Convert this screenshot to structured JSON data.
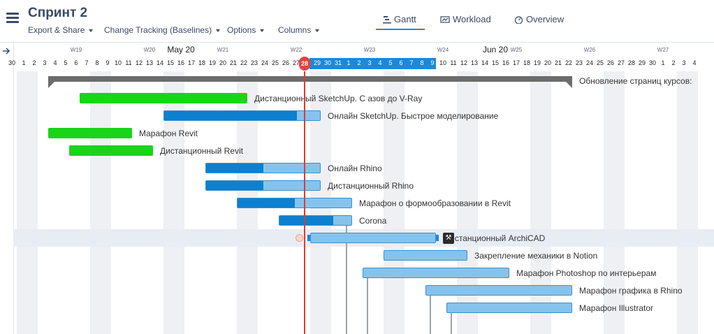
{
  "header": {
    "project_title": "Спринт 2",
    "menus": [
      {
        "label": "Export & Share"
      },
      {
        "label": "Change Tracking (Baselines)"
      },
      {
        "label": "Options"
      },
      {
        "label": "Columns"
      }
    ],
    "view_tabs": [
      {
        "label": "Gantt",
        "icon": "gantt-icon",
        "active": true
      },
      {
        "label": "Workload",
        "icon": "workload-icon",
        "active": false
      },
      {
        "label": "Overview",
        "icon": "gauge-icon",
        "active": false
      }
    ]
  },
  "timescale": {
    "weeks": [
      "W19",
      "W20",
      "W21",
      "W22",
      "W23",
      "W24",
      "W25",
      "W26",
      "W27"
    ],
    "months": [
      "May 20",
      "Jun 20"
    ],
    "days": [
      "30",
      "1",
      "2",
      "3",
      "4",
      "5",
      "6",
      "7",
      "8",
      "9",
      "10",
      "11",
      "12",
      "13",
      "14",
      "15",
      "16",
      "17",
      "18",
      "19",
      "20",
      "21",
      "22",
      "23",
      "24",
      "25",
      "26",
      "27",
      "28",
      "29",
      "30",
      "31",
      "1",
      "2",
      "3",
      "4",
      "5",
      "6",
      "7",
      "8",
      "9",
      "10",
      "11",
      "12",
      "13",
      "14",
      "15",
      "16",
      "17",
      "18",
      "19",
      "20",
      "21",
      "22",
      "23",
      "24",
      "25",
      "26",
      "27",
      "28",
      "29",
      "30",
      "1",
      "2",
      "3",
      "4"
    ],
    "today": "28",
    "highlighted_days": [
      "29",
      "30",
      "31",
      "1",
      "2",
      "3",
      "4",
      "5",
      "6",
      "7",
      "8",
      "9"
    ]
  },
  "summary_task": {
    "label": "Обновление страниц курсов:"
  },
  "tasks": [
    {
      "label": "Дистанционный SketchUp. С азов до V-Ray",
      "color": "#18d518"
    },
    {
      "label": "Онлайн SketchUp. Быстрое моделирование",
      "progress": 0.85
    },
    {
      "label": "Марафон Revit",
      "color": "#18d518"
    },
    {
      "label": "Дистанционный Revit",
      "color": "#18d518"
    },
    {
      "label": "Онлайн Rhino",
      "progress": 0.5
    },
    {
      "label": "Дистанционный Rhino",
      "progress": 0.5
    },
    {
      "label": "Марафон о формообразовании в Revit",
      "progress": 0.5
    },
    {
      "label": "Corona",
      "progress": 0.75
    },
    {
      "label": "Дистанционный ArchiCAD",
      "progress": 0
    },
    {
      "label": "Закрепление механики в Notion",
      "progress": 0
    },
    {
      "label": "Марафон Photoshop по интерьерам",
      "progress": 0
    },
    {
      "label": "Марафон графика в Rhino",
      "progress": 0
    },
    {
      "label": "Марафон Illustrator",
      "progress": 0
    }
  ]
}
